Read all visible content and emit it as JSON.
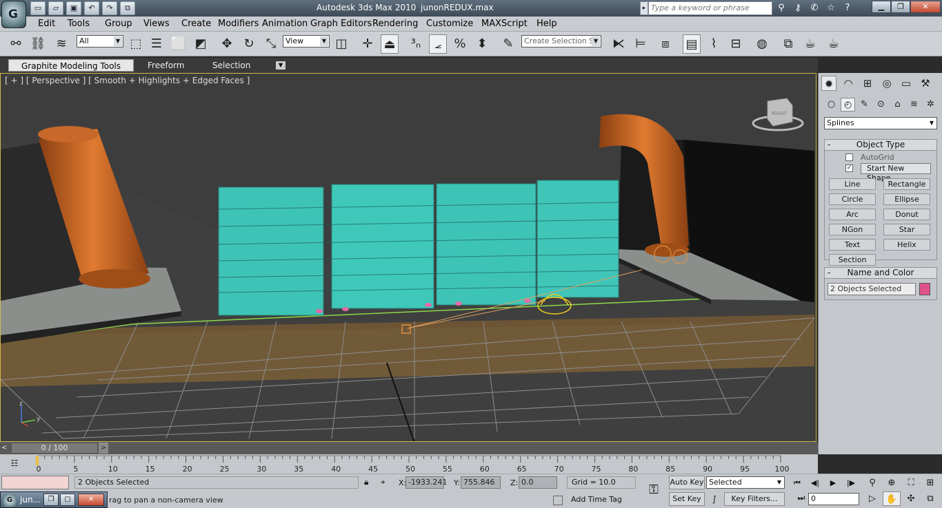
{
  "window": {
    "app_title": "Autodesk 3ds Max  2010",
    "file_title": "junonREDUX.max",
    "search_placeholder": "Type a keyword or phrase",
    "logo_letter": "G"
  },
  "menu": [
    "Edit",
    "Tools",
    "Group",
    "Views",
    "Create",
    "Modifiers",
    "Animation",
    "Graph Editors",
    "Rendering",
    "Customize",
    "MAXScript",
    "Help"
  ],
  "toolbar": {
    "filter_value": "All",
    "refcoord_value": "View",
    "selection_set_placeholder": "Create Selection Se"
  },
  "ribbon": {
    "tabs": [
      "Graphite Modeling Tools",
      "Freeform",
      "Selection"
    ]
  },
  "viewport": {
    "label": "[ + ] [ Perspective ] [ Smooth + Highlights + Edged Faces ]",
    "viewcube_face": "RIGHT",
    "axis_z": "z",
    "axis_y": "y",
    "colors": {
      "background": "#3d3d3d",
      "buildings": "#3ec4b6",
      "pipes": "#d0702a",
      "ground": "#6e5a3c",
      "grid": "#9a9a9a",
      "selection": "#f0d020"
    }
  },
  "command_panel": {
    "category_value": "Splines",
    "object_type_title": "Object Type",
    "autogrid_label": "AutoGrid",
    "start_new_shape_label": "Start New Shape",
    "buttons": [
      "Line",
      "Rectangle",
      "Circle",
      "Ellipse",
      "Arc",
      "Donut",
      "NGon",
      "Star",
      "Text",
      "Helix",
      "Section"
    ],
    "name_color_title": "Name and Color",
    "name_value": "2 Objects Selected",
    "swatch_color": "#e0508a"
  },
  "timeline": {
    "slider_text": "0 / 100",
    "ticks": [
      0,
      5,
      10,
      15,
      20,
      25,
      30,
      35,
      40,
      45,
      50,
      55,
      60,
      65,
      70,
      75,
      80,
      85,
      90,
      95,
      100
    ]
  },
  "status": {
    "selection_text": "2 Objects Selected",
    "prompt_text": "rag to pan a non-camera view",
    "x_label": "X:",
    "x_value": "-1933.241",
    "y_label": "Y:",
    "y_value": "755.846",
    "z_label": "Z:",
    "z_value": "0.0",
    "grid_text": "Grid = 10.0",
    "add_time_tag": "Add Time Tag",
    "auto_key": "Auto Key",
    "set_key": "Set Key",
    "key_mode_value": "Selected",
    "key_filters": "Key Filters...",
    "frame_value": "0"
  },
  "taskbar": {
    "mini_title": "jun..."
  }
}
